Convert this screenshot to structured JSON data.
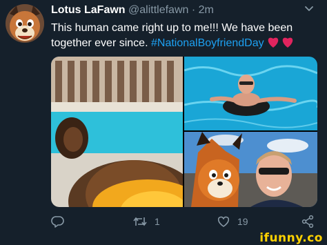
{
  "tweet": {
    "display_name": "Lotus LaFawn",
    "handle": "@alittlefawn",
    "separator": "·",
    "time": "2m",
    "text_main": "This human came right up to me!!! We have been together ever since.",
    "hashtag": "#NationalBoyfriendDay",
    "hearts_emoji": "❤❤",
    "heart_color": "#e0245e",
    "link_color": "#1da1f2"
  },
  "media": {
    "photos": [
      {
        "description_icon": "fursuit-pool-photo"
      },
      {
        "description_icon": "man-in-pool-photo"
      },
      {
        "description_icon": "selfie-photo"
      }
    ]
  },
  "actions": {
    "reply_icon": "reply-icon",
    "retweet_icon": "retweet-icon",
    "retweet_count": "1",
    "like_icon": "heart-icon",
    "like_count": "19",
    "share_icon": "share-icon"
  },
  "watermark": {
    "text": "ifunny.co",
    "color": "#ffd200"
  },
  "colors": {
    "background": "#15202b",
    "secondary_text": "#8899a6"
  }
}
